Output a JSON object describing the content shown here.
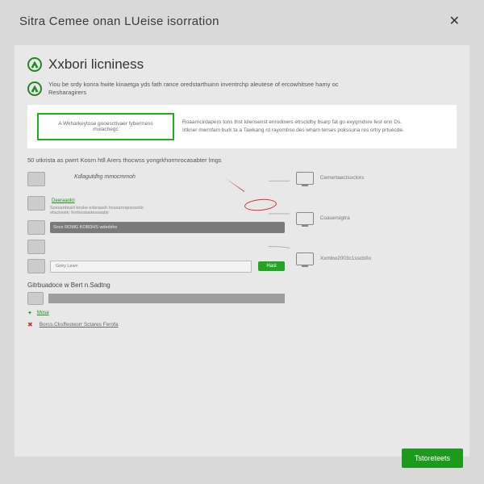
{
  "header": {
    "title": "Sitra Cemee onan LUeise isorration",
    "close": "✕"
  },
  "subheader": {
    "title": "Xxbori licniness"
  },
  "info": {
    "line1": "Yiou be srdy konra hwite kinaetga yds fath rance oredstarthuinn inventrchp aleutese of ercowhitsee hamy oc",
    "line2": "Resharagirers"
  },
  "callout": {
    "highlight": "A Wkharkeytose gooesctivaer fybermess mulachegc",
    "body1": "Roaarncirdapern tons thst kilensenst enrodowrs etrsctdby bsarp fat go exygmdsre fest onn Ds.",
    "body2": "Irtkner mwrnfam burk ta a Tawkang rd rayombso.des wharn terses pokssuria res ortry prtuecde."
  },
  "intro": "50 utkrista as pwrrt Kosrn htll Arers thocwss yongrkhormrocasabter lmgs",
  "diagram": {
    "kb_label": "Kdlagutdhg mmocmmoh",
    "row2_link": "Deeraaolci",
    "row2_text": "Soesardwart keske exbraasb hoasanrapsoastle",
    "row2_text2": "efacbesik: horbootastessaabir",
    "row3_bar": "Soce ROMG KOBDHS wdedshs",
    "note": "Geky Lewn",
    "green_btn": "Hast",
    "section2": "Gitrbuadoce w Bert n.Sadtng",
    "green_small": "Mosa",
    "red_link": "Borcs.Cksffesteorr Sctares Ferofa"
  },
  "monitors": {
    "m1": "Cemertaectsoctors",
    "m2": "Coasersigtra",
    "m3": "Xxmbw2003c1sscb0o"
  },
  "bottom_btn": "Tstoreteets"
}
